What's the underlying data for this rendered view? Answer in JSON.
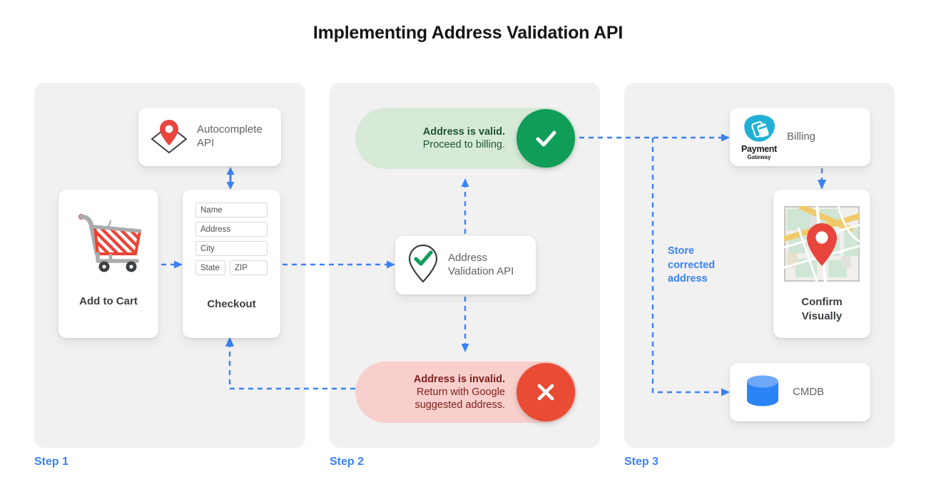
{
  "title": "Implementing Address Validation API",
  "colors": {
    "accent_blue": "#3b82f6",
    "panel_bg": "#f1f1f1",
    "valid_pill_bg": "#d7ead8",
    "valid_badge": "#0f9d58",
    "invalid_pill_bg": "#f8cfcc",
    "invalid_badge": "#ea4b35",
    "pin_red": "#e8453c",
    "cmdb_blue": "#3b82f6",
    "payment_teal": "#22b0d6"
  },
  "steps": [
    {
      "label": "Step 1"
    },
    {
      "label": "Step 2"
    },
    {
      "label": "Step 3"
    }
  ],
  "step1": {
    "autocomplete_card": {
      "label": "Autocomplete\nAPI",
      "icon": "map-pin-envelope-icon"
    },
    "cart_card": {
      "title": "Add to Cart",
      "icon": "shopping-cart-icon"
    },
    "checkout_card": {
      "title": "Checkout",
      "fields": [
        {
          "name": "name-field",
          "placeholder": "Name"
        },
        {
          "name": "address-field",
          "placeholder": "Address"
        },
        {
          "name": "city-field",
          "placeholder": "City"
        },
        {
          "name": "state-field",
          "placeholder": "State"
        },
        {
          "name": "zip-field",
          "placeholder": "ZIP"
        }
      ]
    }
  },
  "step2": {
    "valid_pill": {
      "line1": "Address is valid.",
      "line2": "Proceed to billing.",
      "badge_icon": "checkmark-icon"
    },
    "invalid_pill": {
      "line1": "Address is invalid.",
      "line2": "Return with Google\nsuggested address.",
      "badge_icon": "close-x-icon"
    },
    "validation_card": {
      "label": "Address\nValidation API",
      "icon": "map-pin-check-icon"
    }
  },
  "step3": {
    "billing_card": {
      "label": "Billing",
      "icon": "payment-gateway-logo-icon",
      "logo_text": "Payment",
      "logo_subtext": "Gateway"
    },
    "confirm_card": {
      "title": "Confirm\nVisually",
      "icon": "map-thumbnail-icon"
    },
    "cmdb_card": {
      "label": "CMDB",
      "icon": "database-cylinder-icon"
    },
    "store_note": "Store\ncorrected\naddress"
  },
  "connectors": [
    {
      "name": "cart-to-checkout-arrow",
      "style": "dashed",
      "direction": "right"
    },
    {
      "name": "autocomplete-checkout-bidirectional-arrow",
      "style": "solid",
      "direction": "both"
    },
    {
      "name": "checkout-to-validation-arrow",
      "style": "dashed",
      "direction": "right"
    },
    {
      "name": "validation-to-valid-arrow",
      "style": "dashed",
      "direction": "up"
    },
    {
      "name": "validation-to-invalid-arrow",
      "style": "dashed",
      "direction": "down"
    },
    {
      "name": "valid-to-billing-arrow",
      "style": "dashed",
      "direction": "right"
    },
    {
      "name": "billing-to-confirm-arrow",
      "style": "dashed",
      "direction": "down"
    },
    {
      "name": "store-corrected-to-cmdb-arrow",
      "style": "dashed",
      "direction": "right"
    },
    {
      "name": "invalid-to-checkout-arrow",
      "style": "dashed",
      "direction": "up"
    }
  ]
}
